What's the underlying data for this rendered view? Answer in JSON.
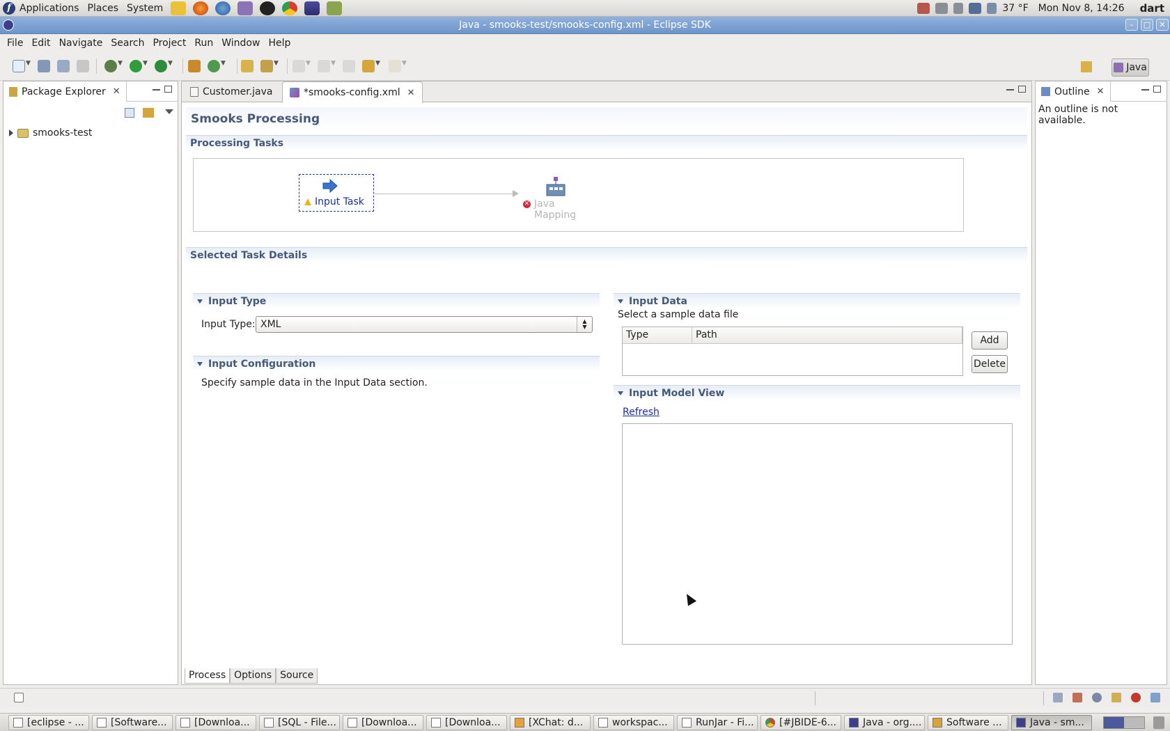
{
  "gnome_panel": {
    "menus": [
      "Applications",
      "Places",
      "System"
    ],
    "weather": "37 °F",
    "clock": "Mon Nov  8, 14:26",
    "user": "dart"
  },
  "window": {
    "title": "Java - smooks-test/smooks-config.xml - Eclipse SDK"
  },
  "menubar": [
    "File",
    "Edit",
    "Navigate",
    "Search",
    "Project",
    "Run",
    "Window",
    "Help"
  ],
  "perspective": {
    "label": "Java"
  },
  "package_explorer": {
    "title": "Package Explorer",
    "tree": [
      {
        "label": "smooks-test"
      }
    ]
  },
  "editor": {
    "tabs": [
      {
        "label": "Customer.java",
        "active": false
      },
      {
        "label": "*smooks-config.xml",
        "active": true
      }
    ],
    "form_title": "Smooks Processing",
    "processing_tasks": {
      "title": "Processing Tasks",
      "nodes": [
        {
          "label": "Input Task",
          "status": "warning"
        },
        {
          "label": "Java Mapping",
          "status": "error"
        }
      ]
    },
    "selected_task_details": {
      "title": "Selected Task Details"
    },
    "input_type": {
      "title": "Input Type",
      "label": "Input Type:",
      "value": "XML"
    },
    "input_configuration": {
      "title": "Input Configuration",
      "text": "Specify sample data in the Input Data section."
    },
    "input_data": {
      "title": "Input Data",
      "subtitle": "Select a sample data file",
      "columns": [
        "Type",
        "Path"
      ],
      "add_label": "Add",
      "delete_label": "Delete"
    },
    "input_model_view": {
      "title": "Input Model View",
      "refresh_label": "Refresh"
    },
    "bottom_tabs": [
      {
        "label": "Process",
        "active": true
      },
      {
        "label": "Options",
        "active": false
      },
      {
        "label": "Source",
        "active": false
      }
    ]
  },
  "outline": {
    "title": "Outline",
    "message": "An outline is not available."
  },
  "taskbar": [
    "[eclipse - ...",
    "[Software...",
    "[Downloa...",
    "[SQL - File...",
    "[Downloa...",
    "[Downloa...",
    "[XChat: d...",
    "workspac...",
    "RunJar - Fi...",
    "[#JBIDE-6...",
    "Java - org....",
    "Software ...",
    "Java - sm..."
  ]
}
